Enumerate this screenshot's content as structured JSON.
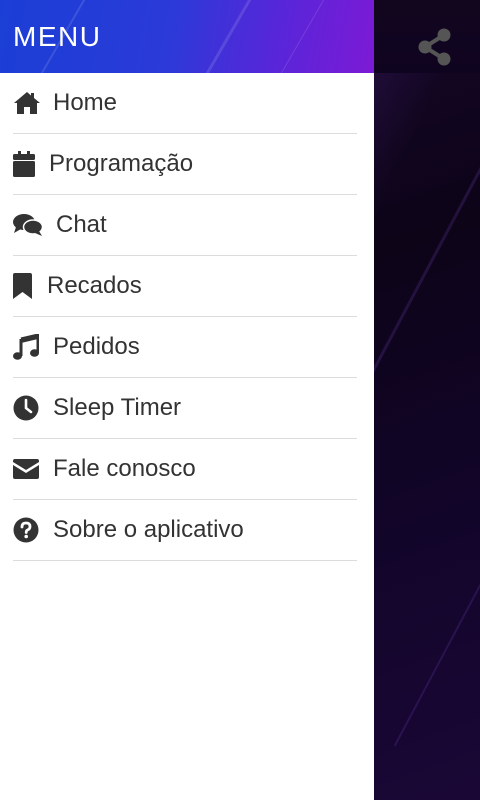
{
  "drawer": {
    "title": "MENU",
    "items": [
      {
        "label": "Home",
        "icon": "home-icon"
      },
      {
        "label": "Programação",
        "icon": "calendar-icon"
      },
      {
        "label": "Chat",
        "icon": "chat-icon"
      },
      {
        "label": "Recados",
        "icon": "bookmark-icon"
      },
      {
        "label": "Pedidos",
        "icon": "music-note-icon"
      },
      {
        "label": "Sleep Timer",
        "icon": "clock-icon"
      },
      {
        "label": "Fale conosco",
        "icon": "envelope-icon"
      },
      {
        "label": "Sobre o aplicativo",
        "icon": "question-circle-icon"
      }
    ]
  },
  "app": {
    "share_icon": "share-icon"
  },
  "colors": {
    "header_start": "#1b3fd6",
    "header_end": "#7d1ad6",
    "text": "#333333",
    "divider": "#dcdcdc",
    "background": "#0d0518"
  }
}
